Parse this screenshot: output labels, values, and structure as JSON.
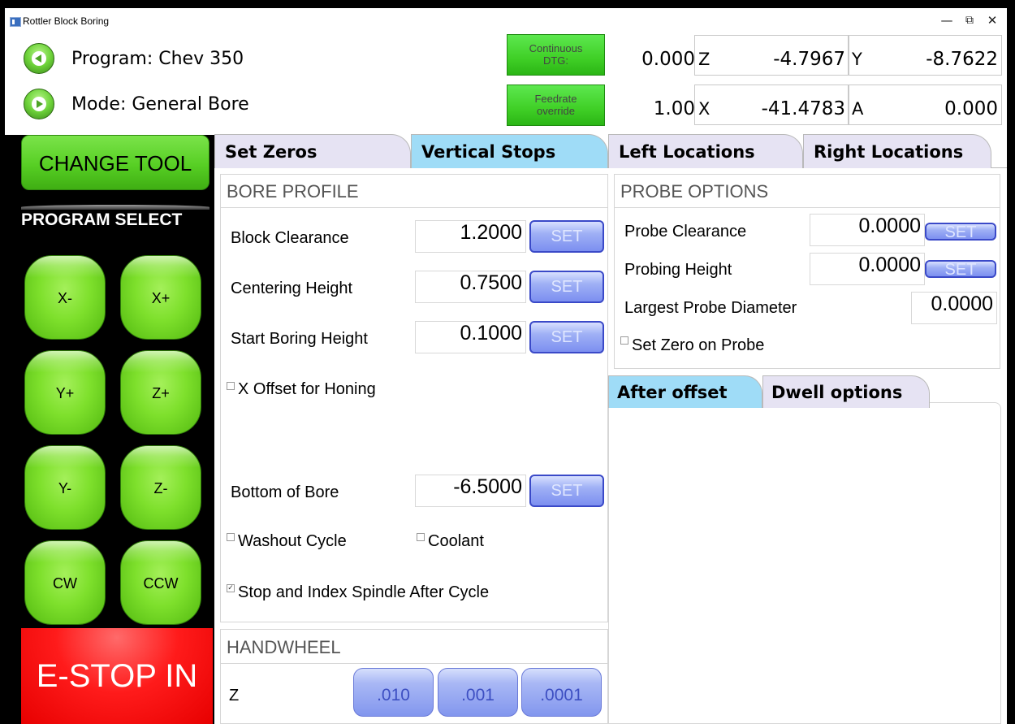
{
  "window": {
    "title": "Rottler Block Boring",
    "minimize": "—",
    "restore": "⧉",
    "close": "✕"
  },
  "header": {
    "program_label": "Program: Chev 350",
    "mode_label": "Mode: General Bore",
    "continuous_btn": {
      "line1": "Continuous",
      "line2": "DTG:"
    },
    "feedrate_btn": {
      "line1": "Feedrate",
      "line2": "override"
    },
    "dtg_value": "0.000",
    "feedrate_value": "1.00",
    "axes": {
      "z": {
        "label": "Z",
        "value": "-4.7967"
      },
      "y": {
        "label": "Y",
        "value": "-8.7622"
      },
      "x": {
        "label": "X",
        "value": "-41.4783"
      },
      "a": {
        "label": "A",
        "value": "0.000"
      }
    }
  },
  "left": {
    "change_tool": "CHANGE TOOL",
    "program_select": "PROGRAM SELECT",
    "jog": {
      "x_minus": "X-",
      "x_plus": "X+",
      "y_plus": "Y+",
      "z_plus": "Z+",
      "y_minus": "Y-",
      "z_minus": "Z-",
      "cw": "CW",
      "ccw": "CCW"
    },
    "estop": "E-STOP IN"
  },
  "tabs": [
    "Set Zeros",
    "Vertical Stops",
    "Left Locations",
    "Right Locations"
  ],
  "bore_profile": {
    "title": "BORE PROFILE",
    "block_clearance": {
      "label": "Block Clearance",
      "value": "1.2000"
    },
    "centering_height": {
      "label": "Centering Height",
      "value": "0.7500"
    },
    "start_boring_height": {
      "label": "Start Boring Height",
      "value": "0.1000"
    },
    "x_offset_honing": {
      "label": "X Offset for Honing",
      "checked": false
    },
    "bottom_of_bore": {
      "label": "Bottom of Bore",
      "value": "-6.5000"
    },
    "washout_cycle": {
      "label": "Washout Cycle",
      "checked": false
    },
    "coolant": {
      "label": "Coolant",
      "checked": false
    },
    "stop_index": {
      "label": "Stop and Index Spindle After Cycle",
      "checked": true
    },
    "set_label": "SET"
  },
  "handwheel": {
    "title": "HANDWHEEL",
    "axis": "Z",
    "steps": [
      ".010",
      ".001",
      ".0001"
    ]
  },
  "probe_options": {
    "title": "PROBE OPTIONS",
    "probe_clearance": {
      "label": "Probe Clearance",
      "value": "0.0000"
    },
    "probing_height": {
      "label": "Probing Height",
      "value": "0.0000"
    },
    "largest_probe_diameter": {
      "label": "Largest Probe Diameter",
      "value": "0.0000"
    },
    "set_zero_on_probe": {
      "label": "Set Zero on Probe",
      "checked": false
    },
    "set_label": "SET"
  },
  "subtabs": [
    "After offset",
    "Dwell options"
  ],
  "colors": {
    "green": "#57cf24",
    "estop_red": "#ff1b1b",
    "tab_active": "#9fdcf7",
    "tab_inactive": "#e6e3f3",
    "set_blue": "#7c8ff0"
  }
}
